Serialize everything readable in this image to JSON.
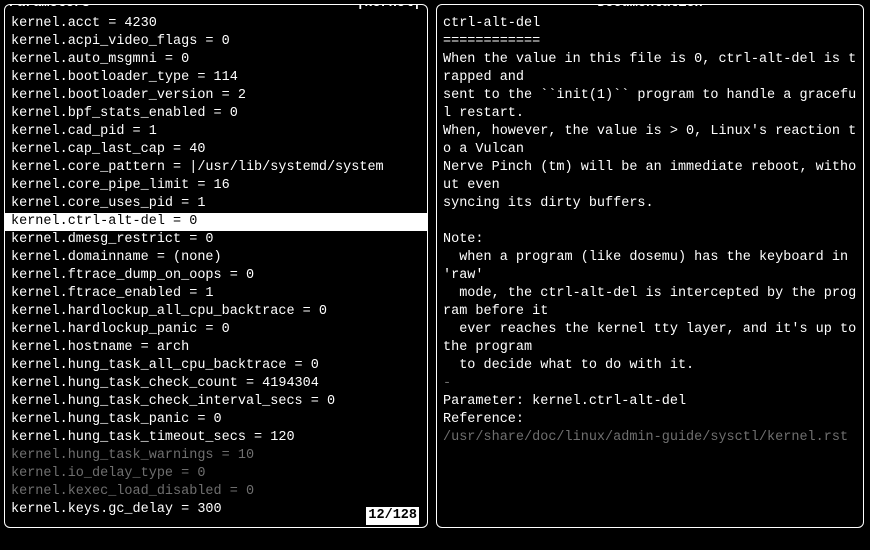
{
  "left": {
    "title": "Parameters",
    "tag": "|kernel|",
    "counter": "12/128",
    "rows": [
      {
        "text": "kernel.acct = 4230",
        "sel": false,
        "dim": false
      },
      {
        "text": "kernel.acpi_video_flags = 0",
        "sel": false,
        "dim": false
      },
      {
        "text": "kernel.auto_msgmni = 0",
        "sel": false,
        "dim": false
      },
      {
        "text": "kernel.bootloader_type = 114",
        "sel": false,
        "dim": false
      },
      {
        "text": "kernel.bootloader_version = 2",
        "sel": false,
        "dim": false
      },
      {
        "text": "kernel.bpf_stats_enabled = 0",
        "sel": false,
        "dim": false
      },
      {
        "text": "kernel.cad_pid = 1",
        "sel": false,
        "dim": false
      },
      {
        "text": "kernel.cap_last_cap = 40",
        "sel": false,
        "dim": false
      },
      {
        "text": "kernel.core_pattern = |/usr/lib/systemd/system",
        "sel": false,
        "dim": false
      },
      {
        "text": "kernel.core_pipe_limit = 16",
        "sel": false,
        "dim": false
      },
      {
        "text": "kernel.core_uses_pid = 1",
        "sel": false,
        "dim": false
      },
      {
        "text": "kernel.ctrl-alt-del = 0",
        "sel": true,
        "dim": false
      },
      {
        "text": "kernel.dmesg_restrict = 0",
        "sel": false,
        "dim": false
      },
      {
        "text": "kernel.domainname = (none)",
        "sel": false,
        "dim": false
      },
      {
        "text": "kernel.ftrace_dump_on_oops = 0",
        "sel": false,
        "dim": false
      },
      {
        "text": "kernel.ftrace_enabled = 1",
        "sel": false,
        "dim": false
      },
      {
        "text": "kernel.hardlockup_all_cpu_backtrace = 0",
        "sel": false,
        "dim": false
      },
      {
        "text": "kernel.hardlockup_panic = 0",
        "sel": false,
        "dim": false
      },
      {
        "text": "kernel.hostname = arch",
        "sel": false,
        "dim": false
      },
      {
        "text": "kernel.hung_task_all_cpu_backtrace = 0",
        "sel": false,
        "dim": false
      },
      {
        "text": "kernel.hung_task_check_count = 4194304",
        "sel": false,
        "dim": false
      },
      {
        "text": "kernel.hung_task_check_interval_secs = 0",
        "sel": false,
        "dim": false
      },
      {
        "text": "kernel.hung_task_panic = 0",
        "sel": false,
        "dim": false
      },
      {
        "text": "kernel.hung_task_timeout_secs = 120",
        "sel": false,
        "dim": false
      },
      {
        "text": "kernel.hung_task_warnings = 10",
        "sel": false,
        "dim": true
      },
      {
        "text": "kernel.io_delay_type = 0",
        "sel": false,
        "dim": true
      },
      {
        "text": "kernel.kexec_load_disabled = 0",
        "sel": false,
        "dim": true
      },
      {
        "text": "kernel.keys.gc_delay = 300",
        "sel": false,
        "dim": false
      }
    ]
  },
  "right": {
    "title": "Documentation",
    "lines": [
      {
        "t": "ctrl-alt-del",
        "dim": false
      },
      {
        "t": "============",
        "dim": false
      },
      {
        "t": "When the value in this file is 0, ctrl-alt-del is trapped and",
        "dim": false
      },
      {
        "t": "sent to the ``init(1)`` program to handle a graceful restart.",
        "dim": false
      },
      {
        "t": "When, however, the value is > 0, Linux's reaction to a Vulcan",
        "dim": false
      },
      {
        "t": "Nerve Pinch (tm) will be an immediate reboot, without even",
        "dim": false
      },
      {
        "t": "syncing its dirty buffers.",
        "dim": false
      },
      {
        "t": "",
        "dim": false
      },
      {
        "t": "Note:",
        "dim": false
      },
      {
        "t": "  when a program (like dosemu) has the keyboard in 'raw'",
        "dim": false
      },
      {
        "t": "  mode, the ctrl-alt-del is intercepted by the program before it",
        "dim": false
      },
      {
        "t": "  ever reaches the kernel tty layer, and it's up to the program",
        "dim": false
      },
      {
        "t": "  to decide what to do with it.",
        "dim": false
      },
      {
        "t": "-",
        "dim": true
      },
      {
        "t": "Parameter: kernel.ctrl-alt-del",
        "dim": false
      },
      {
        "t": "Reference:",
        "dim": false
      },
      {
        "t": "/usr/share/doc/linux/admin-guide/sysctl/kernel.rst",
        "dim": true
      }
    ]
  }
}
